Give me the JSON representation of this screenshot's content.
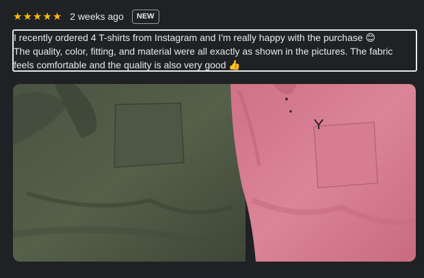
{
  "review": {
    "rating": 5,
    "rating_max": 5,
    "star_icons": [
      "star-icon",
      "star-icon",
      "star-icon",
      "star-icon",
      "star-icon"
    ],
    "time_ago": "2 weeks ago",
    "badge": "NEW",
    "lines": [
      "I recently ordered 4 T-shirts from Instagram and I'm really happy with the purchase 😊",
      "The quality, color, fitting, and material were all exactly as shown in the pictures. The fabric",
      "feels comfortable and the quality is also very good 👍"
    ]
  },
  "colors": {
    "background": "#202124",
    "star": "#fbbc04",
    "text": "#e8eaed",
    "shirt_left": "#4c5443",
    "shirt_right": "#d97e93"
  }
}
